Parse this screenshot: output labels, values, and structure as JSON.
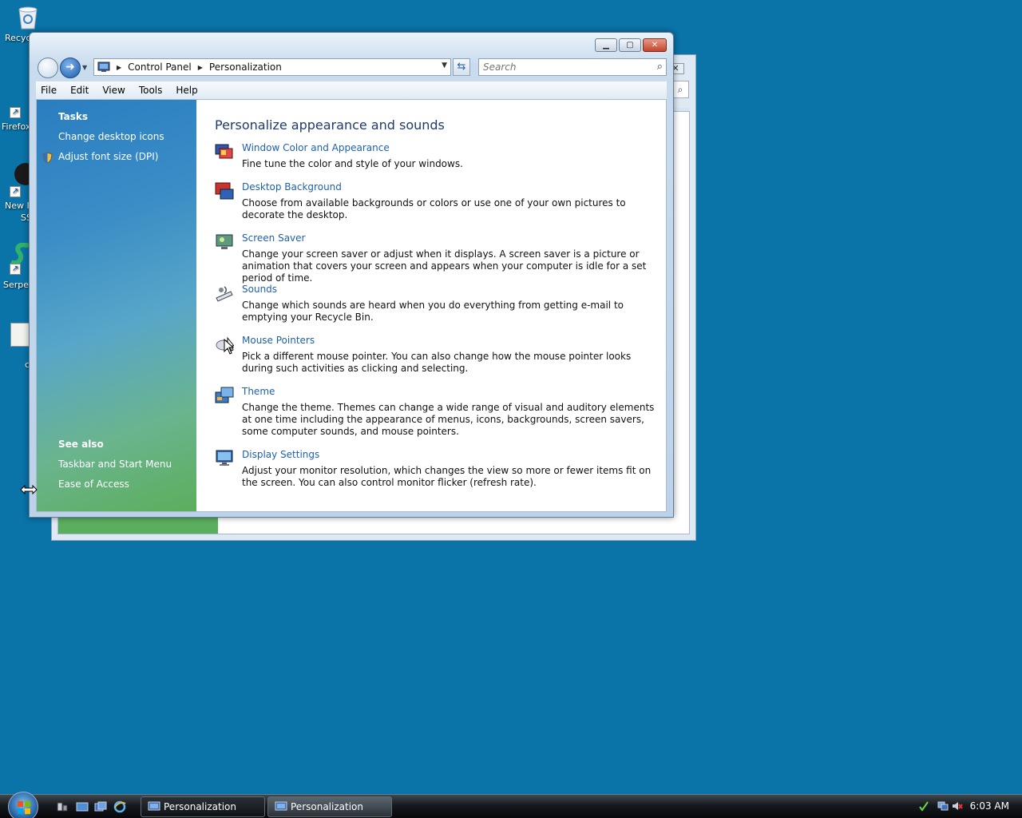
{
  "desktop": {
    "icons": [
      {
        "label": "Recyc"
      },
      {
        "label": "Firefox"
      },
      {
        "label": "New I"
      },
      {
        "label": "SS"
      },
      {
        "label": "Serper"
      },
      {
        "label": "c"
      }
    ]
  },
  "window": {
    "breadcrumb": [
      "Control Panel",
      "Personalization"
    ],
    "search_placeholder": "Search",
    "menu": [
      "File",
      "Edit",
      "View",
      "Tools",
      "Help"
    ],
    "sidebar": {
      "tasks_heading": "Tasks",
      "tasks": [
        "Change desktop icons",
        "Adjust font size (DPI)"
      ],
      "see_also_heading": "See also",
      "see_also": [
        "Taskbar and Start Menu",
        "Ease of Access"
      ]
    },
    "main": {
      "title": "Personalize appearance and sounds",
      "items": [
        {
          "name": "Window Color and Appearance",
          "desc": "Fine tune the color and style of your windows.",
          "icon": "window-color-icon"
        },
        {
          "name": "Desktop Background",
          "desc": "Choose from available backgrounds or colors or use one of your own pictures to decorate the desktop.",
          "icon": "desktop-background-icon"
        },
        {
          "name": "Screen Saver",
          "desc": "Change your screen saver or adjust when it displays. A screen saver is a picture or animation that covers your screen and appears when your computer is idle for a set period of time.",
          "icon": "screen-saver-icon"
        },
        {
          "name": "Sounds",
          "desc": "Change which sounds are heard when you do everything from getting e-mail to emptying your Recycle Bin.",
          "icon": "sounds-icon"
        },
        {
          "name": "Mouse Pointers",
          "desc": "Pick a different mouse pointer. You can also change how the mouse pointer looks during such activities as clicking and selecting.",
          "icon": "mouse-pointers-icon"
        },
        {
          "name": "Theme",
          "desc": "Change the theme. Themes can change a wide range of visual and auditory elements at one time including the appearance of menus, icons, backgrounds, screen savers, some computer sounds, and mouse pointers.",
          "icon": "theme-icon"
        },
        {
          "name": "Display Settings",
          "desc": "Adjust your monitor resolution, which changes the view so more or fewer items fit on the screen. You can also control monitor flicker (refresh rate).",
          "icon": "display-settings-icon"
        }
      ]
    }
  },
  "taskbar": {
    "buttons": [
      "Personalization",
      "Personalization"
    ],
    "clock": "6:03 AM"
  }
}
